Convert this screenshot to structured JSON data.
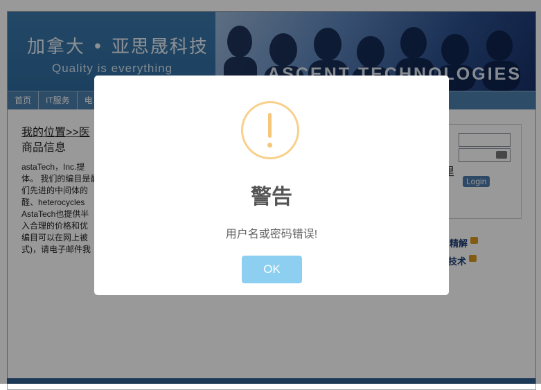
{
  "banner": {
    "title": "加拿大 • 亚思晟科技",
    "tagline": "Quality is everything",
    "brand": "ASCENT TECHNOLOGIES"
  },
  "nav": {
    "items": [
      "首页",
      "IT服务",
      "电"
    ]
  },
  "content": {
    "breadcrumb": "我的位置>>医",
    "section_title": "商品信息",
    "paragraph_lines": [
      "astaTech，Inc.提",
      "体。 我们的编目是最",
      "们先进的中间体的",
      "醛、heterocycles",
      "AstaTech也提供半",
      "入合理的价格和优",
      "编目可以在网上被",
      "式)，请电子邮件我"
    ]
  },
  "login": {
    "login_label": "Login",
    "side_word": "里",
    "link_1": "精解",
    "link_2": "技术"
  },
  "modal": {
    "title": "警告",
    "message": "用户名或密码错误!",
    "ok_label": "OK"
  },
  "colors": {
    "overlay": "#000000",
    "warning_accent": "#f8d08a",
    "ok_button": "#8ccff0",
    "nav": "#4c7fae"
  }
}
